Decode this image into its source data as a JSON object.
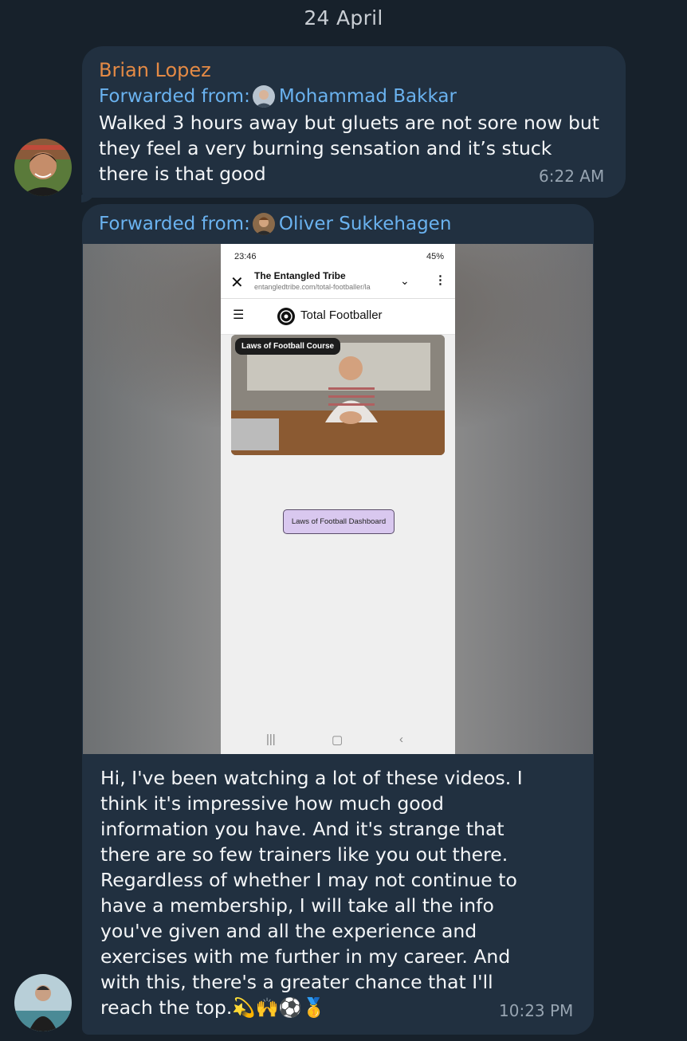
{
  "date_separator": "24 April",
  "messages": [
    {
      "sender": "Brian Lopez",
      "forwarded_label": "Forwarded from:",
      "forwarded_from": "Mohammad Bakkar",
      "text_lines": [
        "Walked 3 hours away but gluets are not sore now but",
        "they feel a very burning sensation and it’s stuck",
        "there is that good"
      ],
      "time": "6:22 AM"
    },
    {
      "forwarded_label": "Forwarded from:",
      "forwarded_from": "Oliver Sukkehagen",
      "media": {
        "status_time": "23:46",
        "status_right": "45%",
        "browser_title": "The Entangled Tribe",
        "browser_url": "entangledtribe.com/total-footballer/la",
        "site_name": "Total Footballer",
        "video_label": "Laws of Football Course",
        "dashboard_button": "Laws of Football Dashboard"
      },
      "text_lines": [
        "Hi, I've been watching a lot of these videos. I",
        "think it's impressive how much good",
        "information you have. And it's strange that",
        "there are so few trainers like you out there.",
        "Regardless of whether I may not continue to",
        "have a membership, I will take all the info",
        "you've given and all the experience and",
        "exercises with me further in my career. And",
        "with this, there's a greater chance that I'll",
        "reach the top.💫🙌⚽🥇"
      ],
      "time": "10:23 PM"
    }
  ],
  "colors": {
    "background": "#17212b",
    "bubble": "#213040",
    "sender_name": "#e48a45",
    "link": "#6ab2ef",
    "time": "#97a4b1"
  }
}
